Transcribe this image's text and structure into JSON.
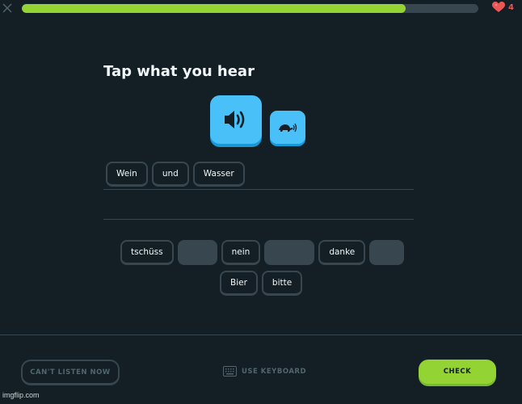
{
  "header": {
    "close_icon": "close-icon",
    "progress_fraction": 0.84,
    "hearts_count": "4",
    "colors": {
      "progress": "#93d333",
      "track": "#37464f",
      "heart": "#ee5555"
    }
  },
  "challenge": {
    "title": "Tap what you hear",
    "speaker_icon": "speaker-icon",
    "slow_icon": "turtle-icon"
  },
  "answer": {
    "selected_words": [
      "Wein",
      "und",
      "Wasser"
    ]
  },
  "word_bank": {
    "row1": [
      {
        "type": "word",
        "label": "tschüss"
      },
      {
        "type": "used",
        "width": "wide"
      },
      {
        "type": "word",
        "label": "nein"
      },
      {
        "type": "used"
      },
      {
        "type": "word",
        "label": "danke"
      },
      {
        "type": "used"
      }
    ],
    "row2": [
      {
        "type": "word",
        "label": "Bier"
      },
      {
        "type": "word",
        "label": "bitte"
      }
    ]
  },
  "footer": {
    "cant_listen_label": "CAN'T LISTEN NOW",
    "use_keyboard_label": "USE KEYBOARD",
    "check_label": "CHECK"
  },
  "watermark": "imgflip.com"
}
